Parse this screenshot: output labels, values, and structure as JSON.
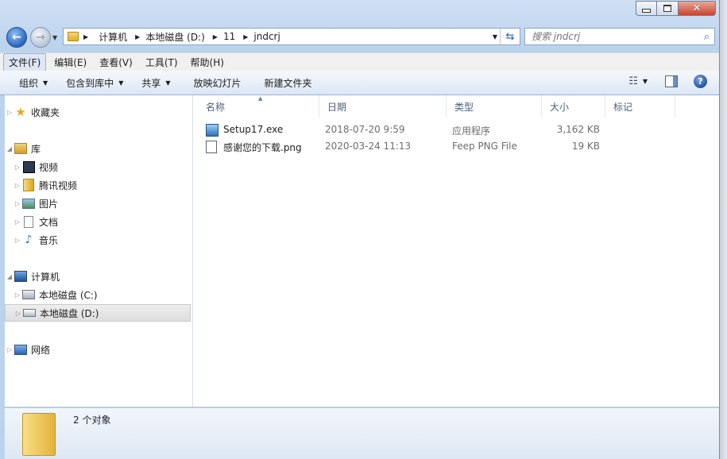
{
  "window": {
    "controls": {
      "minimize_icon": "minimize-icon",
      "maximize_icon": "maximize-icon",
      "close_icon": "close-icon",
      "close_glyph": "✕"
    }
  },
  "nav": {
    "breadcrumbs": [
      "计算机",
      "本地磁盘 (D:)",
      "11",
      "jndcrj"
    ],
    "search_placeholder": "搜索 jndcrj"
  },
  "menu": [
    "文件(F)",
    "编辑(E)",
    "查看(V)",
    "工具(T)",
    "帮助(H)"
  ],
  "toolbar": {
    "organize": "组织",
    "include_in_library": "包含到库中",
    "share": "共享",
    "slideshow": "放映幻灯片",
    "new_folder": "新建文件夹",
    "help_glyph": "?"
  },
  "sidebar": {
    "favorites": "收藏夹",
    "libraries": "库",
    "lib_items": [
      "视频",
      "腾讯视频",
      "图片",
      "文档",
      "音乐"
    ],
    "computer": "计算机",
    "drives": [
      "本地磁盘 (C:)",
      "本地磁盘 (D:)"
    ],
    "selected_drive": "本地磁盘 (D:)",
    "network": "网络"
  },
  "columns": [
    "名称",
    "日期",
    "类型",
    "大小",
    "标记"
  ],
  "files": [
    {
      "name": "Setup17.exe",
      "date": "2018-07-20 9:59",
      "type": "应用程序",
      "size": "3,162 KB",
      "icon": "exe-file-icon"
    },
    {
      "name": "感谢您的下载.png",
      "date": "2020-03-24 11:13",
      "type": "Feep PNG File",
      "size": "19 KB",
      "icon": "png-file-icon"
    }
  ],
  "status": {
    "count": "2 个对象"
  }
}
